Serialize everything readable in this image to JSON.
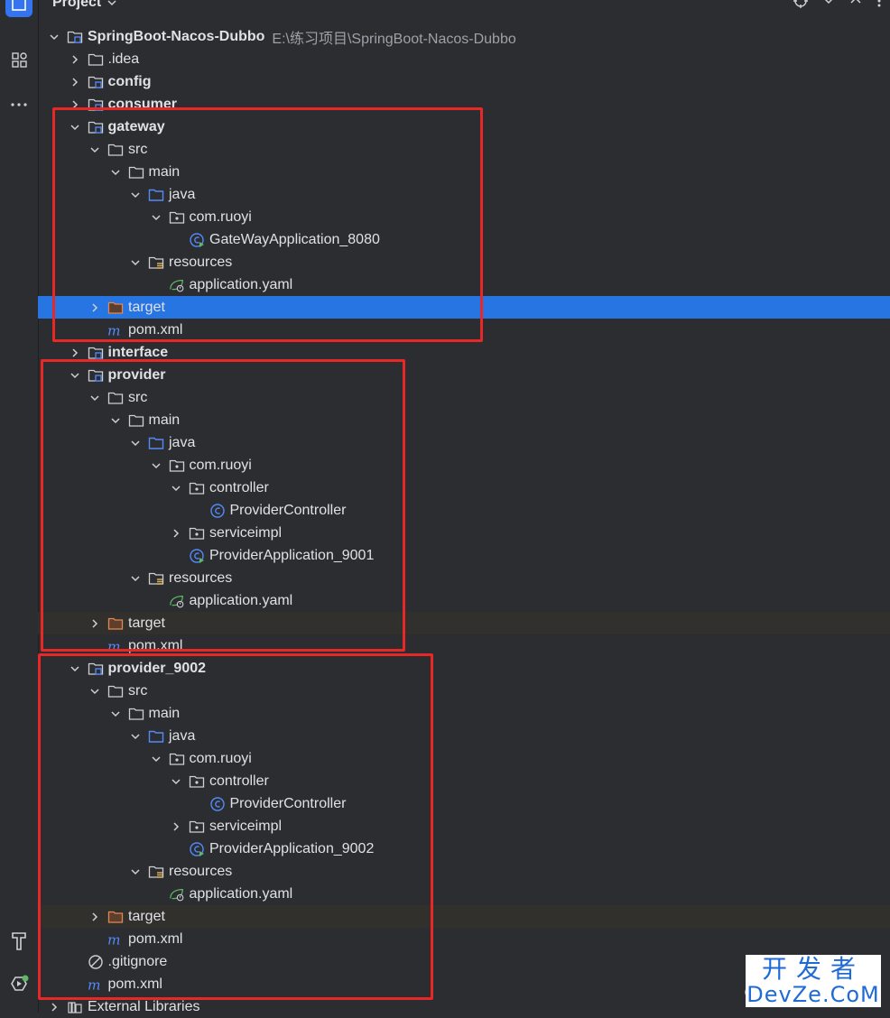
{
  "panel": {
    "title": "Project"
  },
  "root": {
    "label": "SpringBoot-Nacos-Dubbo",
    "path": "E:\\练习项目\\SpringBoot-Nacos-Dubbo"
  },
  "rows": [
    {
      "label": "SpringBoot-Nacos-Dubbo",
      "depth": 0,
      "chev": "down",
      "icon": "module-folder",
      "bold": true,
      "path": "E:\\练习项目\\SpringBoot-Nacos-Dubbo"
    },
    {
      "label": ".idea",
      "depth": 1,
      "chev": "right",
      "icon": "folder"
    },
    {
      "label": "config",
      "depth": 1,
      "chev": "right",
      "icon": "module-folder",
      "bold": true
    },
    {
      "label": "consumer",
      "depth": 1,
      "chev": "right",
      "icon": "module-folder",
      "bold": true
    },
    {
      "label": "gateway",
      "depth": 1,
      "chev": "down",
      "icon": "module-folder",
      "bold": true
    },
    {
      "label": "src",
      "depth": 2,
      "chev": "down",
      "icon": "folder"
    },
    {
      "label": "main",
      "depth": 3,
      "chev": "down",
      "icon": "folder"
    },
    {
      "label": "java",
      "depth": 4,
      "chev": "down",
      "icon": "source-folder"
    },
    {
      "label": "com.ruoyi",
      "depth": 5,
      "chev": "down",
      "icon": "package"
    },
    {
      "label": "GateWayApplication_8080",
      "depth": 6,
      "chev": "none",
      "icon": "spring-app-class"
    },
    {
      "label": "resources",
      "depth": 4,
      "chev": "down",
      "icon": "resources-folder"
    },
    {
      "label": "application.yaml",
      "depth": 5,
      "chev": "none",
      "icon": "spring-config"
    },
    {
      "label": "target",
      "depth": 2,
      "chev": "right",
      "icon": "excluded-folder",
      "state": "selected"
    },
    {
      "label": "pom.xml",
      "depth": 2,
      "chev": "none",
      "icon": "maven"
    },
    {
      "label": "interface",
      "depth": 1,
      "chev": "right",
      "icon": "module-folder",
      "bold": true
    },
    {
      "label": "provider",
      "depth": 1,
      "chev": "down",
      "icon": "module-folder",
      "bold": true
    },
    {
      "label": "src",
      "depth": 2,
      "chev": "down",
      "icon": "folder"
    },
    {
      "label": "main",
      "depth": 3,
      "chev": "down",
      "icon": "folder"
    },
    {
      "label": "java",
      "depth": 4,
      "chev": "down",
      "icon": "source-folder"
    },
    {
      "label": "com.ruoyi",
      "depth": 5,
      "chev": "down",
      "icon": "package"
    },
    {
      "label": "controller",
      "depth": 6,
      "chev": "down",
      "icon": "package"
    },
    {
      "label": "ProviderController",
      "depth": 7,
      "chev": "none",
      "icon": "class"
    },
    {
      "label": "serviceimpl",
      "depth": 6,
      "chev": "right",
      "icon": "package"
    },
    {
      "label": "ProviderApplication_9001",
      "depth": 6,
      "chev": "none",
      "icon": "spring-app-class"
    },
    {
      "label": "resources",
      "depth": 4,
      "chev": "down",
      "icon": "resources-folder"
    },
    {
      "label": "application.yaml",
      "depth": 5,
      "chev": "none",
      "icon": "spring-config"
    },
    {
      "label": "target",
      "depth": 2,
      "chev": "right",
      "icon": "excluded-folder",
      "state": "dim"
    },
    {
      "label": "pom.xml",
      "depth": 2,
      "chev": "none",
      "icon": "maven"
    },
    {
      "label": "provider_9002",
      "depth": 1,
      "chev": "down",
      "icon": "module-folder",
      "bold": true
    },
    {
      "label": "src",
      "depth": 2,
      "chev": "down",
      "icon": "folder"
    },
    {
      "label": "main",
      "depth": 3,
      "chev": "down",
      "icon": "folder"
    },
    {
      "label": "java",
      "depth": 4,
      "chev": "down",
      "icon": "source-folder"
    },
    {
      "label": "com.ruoyi",
      "depth": 5,
      "chev": "down",
      "icon": "package"
    },
    {
      "label": "controller",
      "depth": 6,
      "chev": "down",
      "icon": "package"
    },
    {
      "label": "ProviderController",
      "depth": 7,
      "chev": "none",
      "icon": "class"
    },
    {
      "label": "serviceimpl",
      "depth": 6,
      "chev": "right",
      "icon": "package"
    },
    {
      "label": "ProviderApplication_9002",
      "depth": 6,
      "chev": "none",
      "icon": "spring-app-class"
    },
    {
      "label": "resources",
      "depth": 4,
      "chev": "down",
      "icon": "resources-folder"
    },
    {
      "label": "application.yaml",
      "depth": 5,
      "chev": "none",
      "icon": "spring-config"
    },
    {
      "label": "target",
      "depth": 2,
      "chev": "right",
      "icon": "excluded-folder",
      "state": "dim"
    },
    {
      "label": "pom.xml",
      "depth": 2,
      "chev": "none",
      "icon": "maven"
    },
    {
      "label": ".gitignore",
      "depth": 1,
      "chev": "none",
      "icon": "ignored-file"
    },
    {
      "label": "pom.xml",
      "depth": 1,
      "chev": "none",
      "icon": "maven"
    },
    {
      "label": "External Libraries",
      "depth": 0,
      "chev": "right",
      "icon": "libraries"
    }
  ],
  "watermark": {
    "top": "开发者",
    "bottom": "DevZe.CoM",
    "partial": "C"
  },
  "colors": {
    "selection": "#2675e3",
    "highlight_box": "#e82727",
    "accent": "#3574f0"
  }
}
